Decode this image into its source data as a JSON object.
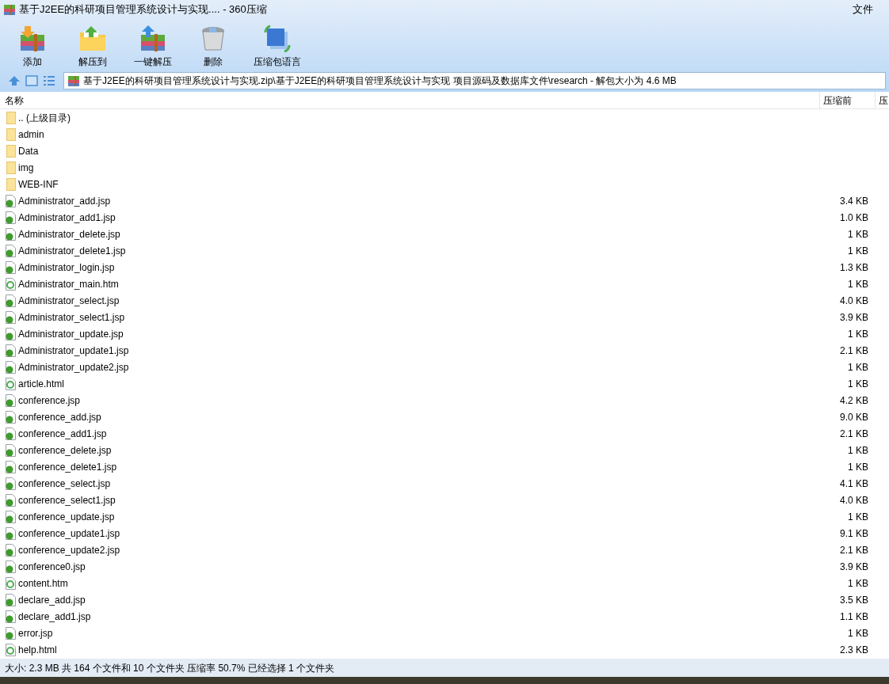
{
  "window": {
    "title": "基于J2EE的科研项目管理系统设计与实现.... - 360压缩",
    "menu": "文件"
  },
  "toolbar": [
    {
      "label": "添加",
      "kind": "add"
    },
    {
      "label": "解压到",
      "kind": "extract"
    },
    {
      "label": "一键解压",
      "kind": "oneclick"
    },
    {
      "label": "删除",
      "kind": "delete"
    },
    {
      "label": "压缩包语言",
      "kind": "language"
    }
  ],
  "address": {
    "value": "基于J2EE的科研项目管理系统设计与实现.zip\\基于J2EE的科研项目管理系统设计与实现 项目源码及数据库文件\\research - 解包大小为 4.6 MB"
  },
  "columns": [
    "名称",
    "压缩前",
    "压"
  ],
  "rows": [
    {
      "name": ".. (上级目录)",
      "size": "",
      "kind": "folder"
    },
    {
      "name": "admin",
      "size": "",
      "kind": "folder"
    },
    {
      "name": "Data",
      "size": "",
      "kind": "folder"
    },
    {
      "name": "img",
      "size": "",
      "kind": "folder"
    },
    {
      "name": "WEB-INF",
      "size": "",
      "kind": "folder"
    },
    {
      "name": "Administrator_add.jsp",
      "size": "3.4 KB",
      "kind": "jsp"
    },
    {
      "name": "Administrator_add1.jsp",
      "size": "1.0 KB",
      "kind": "jsp"
    },
    {
      "name": "Administrator_delete.jsp",
      "size": "1 KB",
      "kind": "jsp"
    },
    {
      "name": "Administrator_delete1.jsp",
      "size": "1 KB",
      "kind": "jsp"
    },
    {
      "name": "Administrator_login.jsp",
      "size": "1.3 KB",
      "kind": "jsp"
    },
    {
      "name": "Administrator_main.htm",
      "size": "1 KB",
      "kind": "html"
    },
    {
      "name": "Administrator_select.jsp",
      "size": "4.0 KB",
      "kind": "jsp"
    },
    {
      "name": "Administrator_select1.jsp",
      "size": "3.9 KB",
      "kind": "jsp"
    },
    {
      "name": "Administrator_update.jsp",
      "size": "1 KB",
      "kind": "jsp"
    },
    {
      "name": "Administrator_update1.jsp",
      "size": "2.1 KB",
      "kind": "jsp"
    },
    {
      "name": "Administrator_update2.jsp",
      "size": "1 KB",
      "kind": "jsp"
    },
    {
      "name": "article.html",
      "size": "1 KB",
      "kind": "html"
    },
    {
      "name": "conference.jsp",
      "size": "4.2 KB",
      "kind": "jsp"
    },
    {
      "name": "conference_add.jsp",
      "size": "9.0 KB",
      "kind": "jsp"
    },
    {
      "name": "conference_add1.jsp",
      "size": "2.1 KB",
      "kind": "jsp"
    },
    {
      "name": "conference_delete.jsp",
      "size": "1 KB",
      "kind": "jsp"
    },
    {
      "name": "conference_delete1.jsp",
      "size": "1 KB",
      "kind": "jsp"
    },
    {
      "name": "conference_select.jsp",
      "size": "4.1 KB",
      "kind": "jsp"
    },
    {
      "name": "conference_select1.jsp",
      "size": "4.0 KB",
      "kind": "jsp"
    },
    {
      "name": "conference_update.jsp",
      "size": "1 KB",
      "kind": "jsp"
    },
    {
      "name": "conference_update1.jsp",
      "size": "9.1 KB",
      "kind": "jsp"
    },
    {
      "name": "conference_update2.jsp",
      "size": "2.1 KB",
      "kind": "jsp"
    },
    {
      "name": "conference0.jsp",
      "size": "3.9 KB",
      "kind": "jsp"
    },
    {
      "name": "content.htm",
      "size": "1 KB",
      "kind": "html"
    },
    {
      "name": "declare_add.jsp",
      "size": "3.5 KB",
      "kind": "jsp"
    },
    {
      "name": "declare_add1.jsp",
      "size": "1.1 KB",
      "kind": "jsp"
    },
    {
      "name": "error.jsp",
      "size": "1 KB",
      "kind": "jsp"
    },
    {
      "name": "help.html",
      "size": "2.3 KB",
      "kind": "html"
    }
  ],
  "status_bar": "大小: 2.3 MB 共 164 个文件和 10 个文件夹 压缩率 50.7% 已经选择 1 个文件夹"
}
